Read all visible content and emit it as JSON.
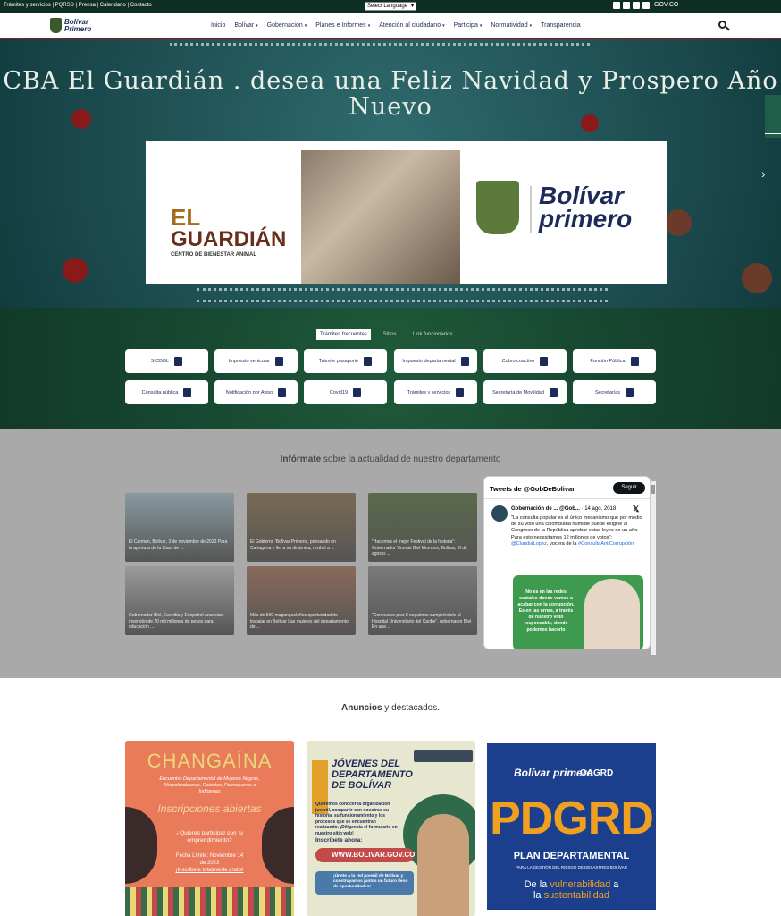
{
  "topbar": {
    "links": "Trámites y servicios | PQRSD | Prensa | Calendario | Contacto",
    "language": "Select Language",
    "gov": "GOV.CO",
    "social_icons": [
      "facebook-icon",
      "twitter-icon",
      "youtube-icon",
      "instagram-icon"
    ]
  },
  "nav": {
    "logo_text_1": "Bolívar",
    "logo_text_2": "Primero",
    "items": [
      {
        "label": "Inicio",
        "caret": false
      },
      {
        "label": "Bolívar",
        "caret": true
      },
      {
        "label": "Gobernación",
        "caret": true
      },
      {
        "label": "Planes e Informes",
        "caret": true
      },
      {
        "label": "Atención al ciudadano",
        "caret": true
      },
      {
        "label": "Participa",
        "caret": true
      },
      {
        "label": "Normatividad",
        "caret": true
      },
      {
        "label": "Transparencia",
        "caret": false
      }
    ]
  },
  "hero": {
    "title": "CBA El Guardián . desea una Feliz Navidad y Prospero Año Nuevo",
    "el": "EL",
    "guardian": "GUARDIÁN",
    "center": "CENTRO DE BIENESTAR ANIMAL",
    "brand": "Bolívar primero"
  },
  "tramites": {
    "tabs": [
      "Trámites frecuentes",
      "Sitios",
      "Link funcionarios"
    ],
    "buttons": [
      {
        "label": "SICBOL",
        "icon": "edit-icon"
      },
      {
        "label": "Impuesto vehicular",
        "icon": "car-icon"
      },
      {
        "label": "Trámite pasaporte",
        "icon": "passport-icon"
      },
      {
        "label": "Impuesto departamental",
        "icon": "document-icon"
      },
      {
        "label": "Cobro coactivo",
        "icon": "folder-icon"
      },
      {
        "label": "Función Pública",
        "icon": "hand-icon"
      },
      {
        "label": "Consulta pública",
        "icon": "search-icon"
      },
      {
        "label": "Notificación por Aviso",
        "icon": "megaphone-icon"
      },
      {
        "label": "Covid19",
        "icon": "medical-icon"
      },
      {
        "label": "Trámites y servicios",
        "icon": "folder-open-icon"
      },
      {
        "label": "Secretaría de Movilidad",
        "icon": "car-icon"
      },
      {
        "label": "Secretarías",
        "icon": "id-card-icon"
      }
    ]
  },
  "news": {
    "heading_bold": "Infórmate",
    "heading_rest": " sobre la actualidad de nuestro departamento",
    "items": [
      {
        "caption": "El Carmen, Bolívar, 3 de noviembre de 2023 Para la apertura de la Casa de ..."
      },
      {
        "caption": "El Gobierno 'Bolívar Primero', pensando en Cartagena y fiel a su dinámica, recibió a ..."
      },
      {
        "caption": "\"Hacemos el mejor Festival de la historia\": Gobernador Vicente Blel Mompox, Bolívar, 3l de agosto ..."
      },
      {
        "caption": "Gobernador Blel, Esenttia y Ecopetrol anuncian inversión de 20 mil millones de pesos para educación ..."
      },
      {
        "caption": "Más de 500 magangueleños oportunidad de trabajar en Bolívar Las mujeres del departamento de ..."
      },
      {
        "caption": "\"Con nuevo piso 8 seguimos cumpliéndole al Hospital Universitario del Caribe\", gobernador Blel En una ..."
      }
    ],
    "thumb_colors": [
      "#8a9aa0",
      "#7a6a54",
      "#5a6a4a",
      "#9a9a9a",
      "#8a6a5a",
      "#7a7a7a"
    ]
  },
  "tweets": {
    "header": "Tweets de @GobDeBolivar",
    "follow": "Seguir",
    "author": "Gobernación de ... @Gob...",
    "date": "· 14 ago. 2018",
    "body_1": "\"La consulta popular es el único mecanismo que por medio de su voto una colombiana humilde puede exigirle al Congreso de la República aprobar estas leyes en un año. Para esto necesitamos 12 millones de votos\":",
    "mention": "@ClaudiaLopez",
    "body_2": ", vocera de la",
    "hashtag": "#ConsultaAntiCorrupción",
    "image_text": "No es en las redes sociales donde vamos a acabar con la corrupción. Es en las urnas, a través de nuestro voto responsable, donde podemos hacerlo"
  },
  "ads": {
    "heading_bold": "Anuncios",
    "heading_rest": " y destacados.",
    "ad1": {
      "title": "CHANGAÍNA",
      "sub": "Encuentro Departamental de Mujeres Negras, Afrocolombianas, Raizales, Palenqueras e Indígenas",
      "big": "Inscripciones abiertas",
      "question": "¿Quieres participar con tu emprendimiento?",
      "date": "Fecha Límite: Noviembre 14 de 2023",
      "free": "¡Inscríbete totalmente gratis!"
    },
    "ad2": {
      "title": "JÓVENES DEL DEPARTAMENTO DE BOLÍVAR",
      "text": "Queremos conocer la organización juvenil, compartir con nosotros su historia, su funcionamiento y los procesos que se encuentran realizando. ¡Diligencia el formulario en nuestro sitio web!",
      "subscribe": "Inscríbete ahora:",
      "url": "WWW.BOLIVAR.GOV.CO",
      "cta": "¡Únete a la red juvenil de Bolívar y construyamos juntos un futuro lleno de oportunidades!"
    },
    "ad3": {
      "brand": "Bolívar primero",
      "org": "OAGRD",
      "big": "PDGRD",
      "plan": "PLAN DEPARTAMENTAL",
      "plan_sub": "PARA LA GESTIÓN DEL RIESGO DE DESASTRES BOLÍVAR",
      "vul_1": "De la ",
      "vul_2": "vulnerabilidad",
      "vul_3": " a",
      "vul_4": "la ",
      "vul_5": "sustentabilidad"
    }
  }
}
